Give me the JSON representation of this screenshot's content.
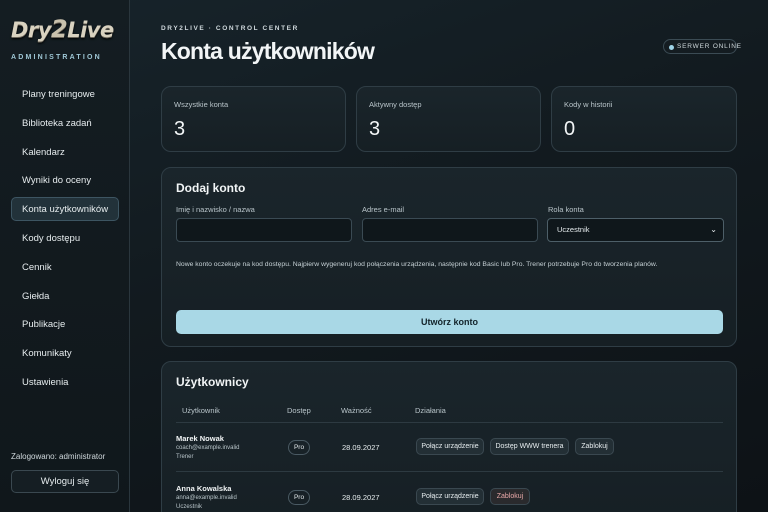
{
  "brand": {
    "logo_a": "Dry",
    "logo_b": "2",
    "logo_c": "Live",
    "section": "ADMINISTRATION"
  },
  "sidebar": {
    "items": [
      {
        "label": "Plany treningowe"
      },
      {
        "label": "Biblioteka zadań"
      },
      {
        "label": "Kalendarz"
      },
      {
        "label": "Wyniki do oceny"
      },
      {
        "label": "Konta użytkowników",
        "active": true
      },
      {
        "label": "Kody dostępu"
      },
      {
        "label": "Cennik"
      },
      {
        "label": "Giełda"
      },
      {
        "label": "Publikacje"
      },
      {
        "label": "Komunikaty"
      },
      {
        "label": "Ustawienia"
      }
    ],
    "logged_in": "Zalogowano: administrator",
    "logout_label": "Wyloguj się"
  },
  "header": {
    "eyebrow": "DRY2LIVE · CONTROL CENTER",
    "title": "Konta użytkowników",
    "server_status": "SERWER ONLINE"
  },
  "stats": [
    {
      "label": "Wszystkie konta",
      "value": "3"
    },
    {
      "label": "Aktywny dostęp",
      "value": "3"
    },
    {
      "label": "Kody w historii",
      "value": "0"
    }
  ],
  "add_account": {
    "title": "Dodaj konto",
    "name_label": "Imię i nazwisko / nazwa",
    "name_value": "",
    "email_label": "Adres e-mail",
    "email_value": "",
    "role_label": "Rola konta",
    "role_value": "Uczestnik",
    "note": "Nowe konto oczekuje na kod dostępu. Najpierw wygeneruj kod połączenia urządzenia, następnie kod Basic lub Pro. Trener potrzebuje Pro do tworzenia planów.",
    "submit_label": "Utwórz konto"
  },
  "users": {
    "title": "Użytkownicy",
    "columns": [
      "Użytkownik",
      "Dostęp",
      "Ważność",
      "Działania"
    ],
    "rows": [
      {
        "name": "Marek Nowak",
        "email": "coach@example.invalid",
        "role": "Trener",
        "access": "Pro",
        "valid_until": "28.09.2027",
        "actions": [
          "Połącz urządzenie",
          "Dostęp WWW trenera",
          "Zablokuj"
        ]
      },
      {
        "name": "Anna Kowalska",
        "email": "anna@example.invalid",
        "role": "Uczestnik",
        "access": "Pro",
        "valid_until": "28.09.2027",
        "actions": [
          "Połącz urządzenie",
          "Zablokuj"
        ]
      }
    ]
  },
  "colors": {
    "accent": "#a9d8e6",
    "danger_text": "#e8a8a8",
    "background": "#121a1f"
  }
}
